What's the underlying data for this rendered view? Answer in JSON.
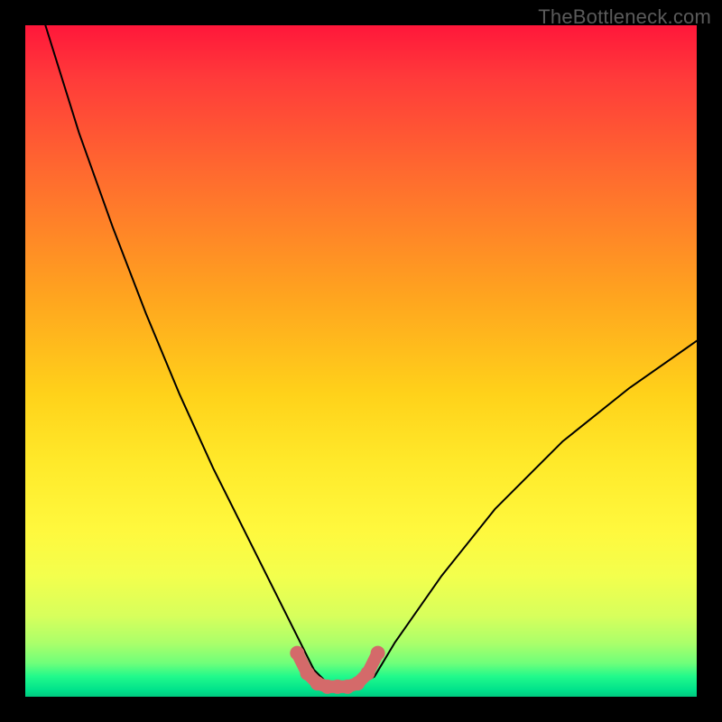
{
  "watermark": "TheBottleneck.com",
  "chart_data": {
    "type": "line",
    "title": "",
    "xlabel": "",
    "ylabel": "",
    "xlim": [
      0,
      100
    ],
    "ylim": [
      0,
      100
    ],
    "series": [
      {
        "name": "black-curve",
        "x": [
          3,
          8,
          13,
          18,
          23,
          28,
          33,
          38,
          41,
          43,
          45,
          47,
          49,
          52,
          55,
          62,
          70,
          80,
          90,
          100
        ],
        "y": [
          100,
          84,
          70,
          57,
          45,
          34,
          24,
          14,
          8,
          4,
          2,
          1.5,
          1.5,
          3,
          8,
          18,
          28,
          38,
          46,
          53
        ],
        "color": "#000000",
        "stroke_width": 2
      },
      {
        "name": "pink-segment",
        "x": [
          40.5,
          42,
          43.5,
          45,
          46.5,
          48,
          49.5,
          51,
          52.5
        ],
        "y": [
          6.5,
          3.5,
          2.0,
          1.5,
          1.5,
          1.5,
          2.0,
          3.5,
          6.5
        ],
        "color": "#d46a6a",
        "stroke_width": 14
      }
    ]
  }
}
